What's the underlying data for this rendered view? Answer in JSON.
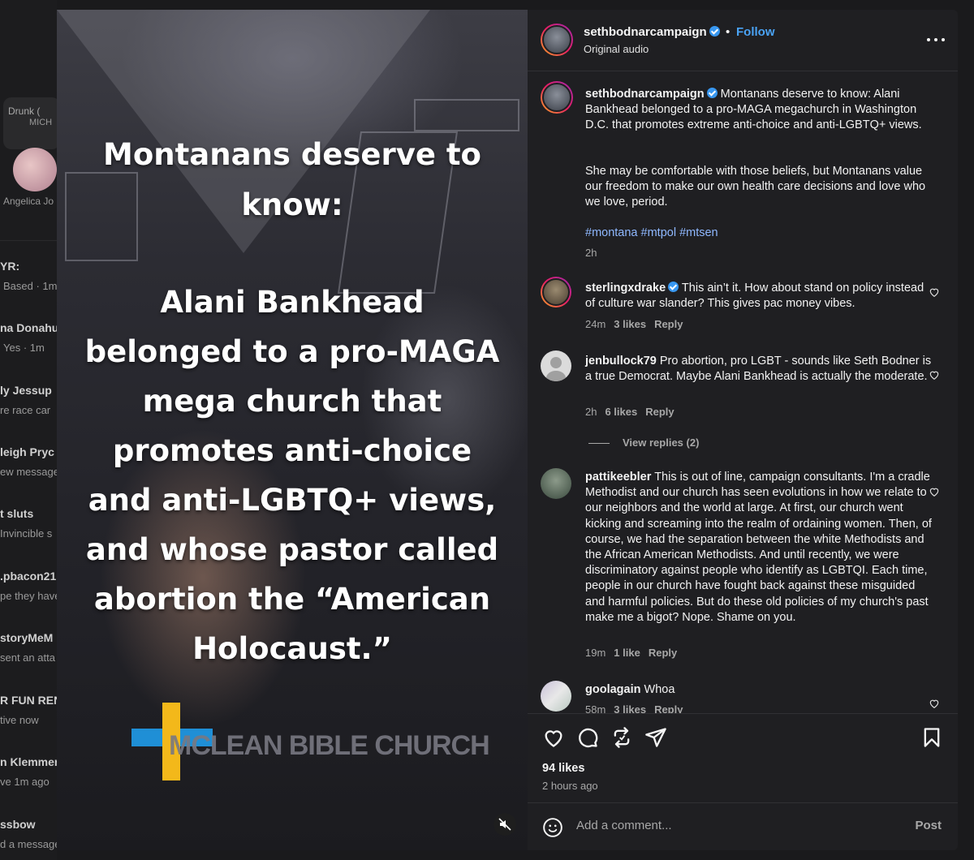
{
  "background_feed": {
    "items": [
      {
        "text": "Drunk (",
        "bold": false
      },
      {
        "text": "MICH",
        "bold": false
      },
      {
        "text": "Angelica Jo",
        "bold": false
      },
      {
        "text": "YR:",
        "bold": true
      },
      {
        "text": "Based · 1m",
        "bold": false
      },
      {
        "text": "na Donahu",
        "bold": true
      },
      {
        "text": "Yes · 1m",
        "bold": false
      },
      {
        "text": "ly Jessup",
        "bold": true
      },
      {
        "text": "re race car",
        "bold": false
      },
      {
        "text": "leigh Pryc",
        "bold": true
      },
      {
        "text": "ew message",
        "bold": false
      },
      {
        "text": "t sluts",
        "bold": true
      },
      {
        "text": "Invincible s",
        "bold": false
      },
      {
        "text": ".pbacon21",
        "bold": true
      },
      {
        "text": "pe they have",
        "bold": false
      },
      {
        "text": "storyMeM",
        "bold": true
      },
      {
        "text": "sent an atta",
        "bold": false
      },
      {
        "text": "R FUN REN",
        "bold": true
      },
      {
        "text": "tive now",
        "bold": false
      },
      {
        "text": "n Klemmer",
        "bold": true
      },
      {
        "text": "ve 1m ago",
        "bold": false
      },
      {
        "text": "ssbow",
        "bold": true
      },
      {
        "text": "d a message",
        "bold": false
      }
    ]
  },
  "media": {
    "headline": [
      "Montanans deserve to",
      "know:"
    ],
    "body": [
      "Alani Bankhead",
      "belonged to a pro-MAGA",
      "mega church that",
      "promotes anti-choice",
      "and anti-LGBTQ+ views,",
      "and whose pastor called",
      "abortion the “American",
      "Holocaust.”"
    ],
    "logo_text": "MCLEAN BIBLE CHURCH",
    "mute_icon": "speaker-muted-icon"
  },
  "header": {
    "username": "sethbodnarcampaign",
    "separator": "•",
    "follow_label": "Follow",
    "audio": "Original audio"
  },
  "caption": {
    "username": "sethbodnarcampaign",
    "text1": "Montanans deserve to know: Alani Bankhead belonged to a pro-MAGA megachurch in Washington D.C. that promotes extreme anti-choice and anti-LGBTQ+ views.",
    "text2": "She may be comfortable with those beliefs, but Montanans value our freedom to make our own health care decisions and love who we love, period.",
    "hashtags": "#montana #mtpol #mtsen",
    "time": "2h"
  },
  "comments": [
    {
      "username": "sterlingxdrake",
      "verified": true,
      "text": "This ain’t it. How about stand on policy instead of culture war slander? This gives pac money vibes.",
      "time": "24m",
      "likes": "3 likes",
      "reply": "Reply"
    },
    {
      "username": "jenbullock79",
      "verified": false,
      "text": "Pro abortion, pro LGBT - sounds like Seth Bodner is a true Democrat. Maybe Alani Bankhead is actually the moderate.",
      "time": "2h",
      "likes": "6 likes",
      "reply": "Reply",
      "view_replies": "View replies (2)"
    },
    {
      "username": "pattikeebler",
      "verified": false,
      "text": "This is out of line, campaign consultants. I'm a cradle Methodist and our church has seen evolutions in how we relate to our neighbors and the world at large. At first, our church went kicking and screaming into the realm of ordaining women. Then, of course, we had the separation between the white Methodists and the African American Methodists. And until recently, we were discriminatory against people who identify as LGBTQI. Each time, people in our church have fought back against these misguided and harmful policies. But do these old policies of my church's past make me a bigot? Nope. Shame on you.",
      "time": "19m",
      "likes": "1 like",
      "reply": "Reply"
    },
    {
      "username": "goolagain",
      "verified": false,
      "text": "Whoa",
      "time": "58m",
      "likes": "3 likes",
      "reply": "Reply"
    }
  ],
  "actions": {
    "likes": "94 likes",
    "ago": "2 hours ago"
  },
  "add_comment": {
    "placeholder": "Add a comment...",
    "post_label": "Post"
  },
  "colors": {
    "link": "#4aa3f5",
    "verified": "#3897f0",
    "panel_bg": "#1f1f22"
  }
}
